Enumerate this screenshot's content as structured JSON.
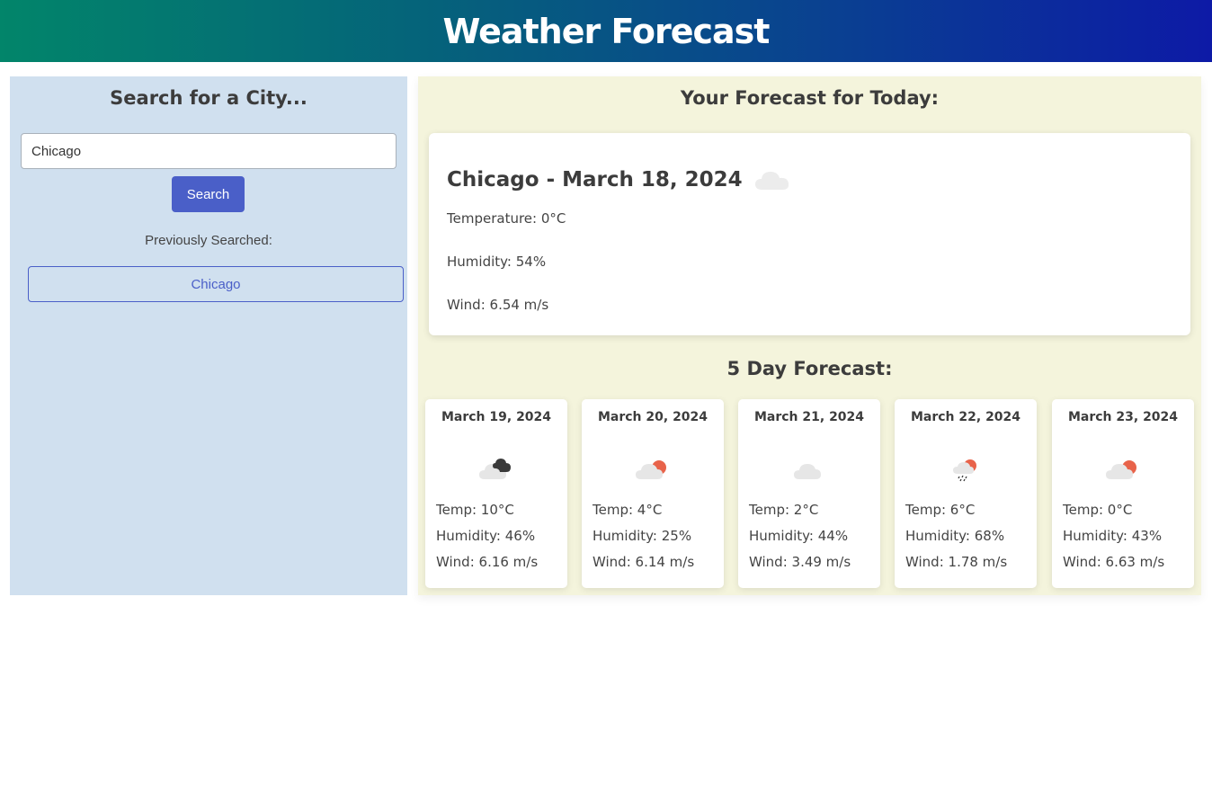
{
  "header": {
    "title": "Weather Forecast"
  },
  "search": {
    "title": "Search for a City...",
    "input_value": "Chicago",
    "button_label": "Search",
    "previous_label": "Previously Searched:",
    "history": [
      "Chicago"
    ]
  },
  "today": {
    "heading": "Your Forecast for Today:",
    "title": "Chicago - March 18, 2024",
    "icon": "cloud-icon",
    "temperature": "Temperature: 0°C",
    "humidity": "Humidity: 54%",
    "wind": "Wind: 6.54 m/s"
  },
  "five_day": {
    "heading": "5 Day Forecast:",
    "days": [
      {
        "date": "March 19, 2024",
        "icon": "broken-clouds-icon",
        "temp": "Temp: 10°C",
        "humidity": "Humidity: 46%",
        "wind": "Wind: 6.16 m/s"
      },
      {
        "date": "March 20, 2024",
        "icon": "partly-cloudy-icon",
        "temp": "Temp: 4°C",
        "humidity": "Humidity: 25%",
        "wind": "Wind: 6.14 m/s"
      },
      {
        "date": "March 21, 2024",
        "icon": "cloud-icon",
        "temp": "Temp: 2°C",
        "humidity": "Humidity: 44%",
        "wind": "Wind: 3.49 m/s"
      },
      {
        "date": "March 22, 2024",
        "icon": "rain-sun-icon",
        "temp": "Temp: 6°C",
        "humidity": "Humidity: 68%",
        "wind": "Wind: 1.78 m/s"
      },
      {
        "date": "March 23, 2024",
        "icon": "partly-cloudy-icon",
        "temp": "Temp: 0°C",
        "humidity": "Humidity: 43%",
        "wind": "Wind: 6.63 m/s"
      }
    ]
  }
}
